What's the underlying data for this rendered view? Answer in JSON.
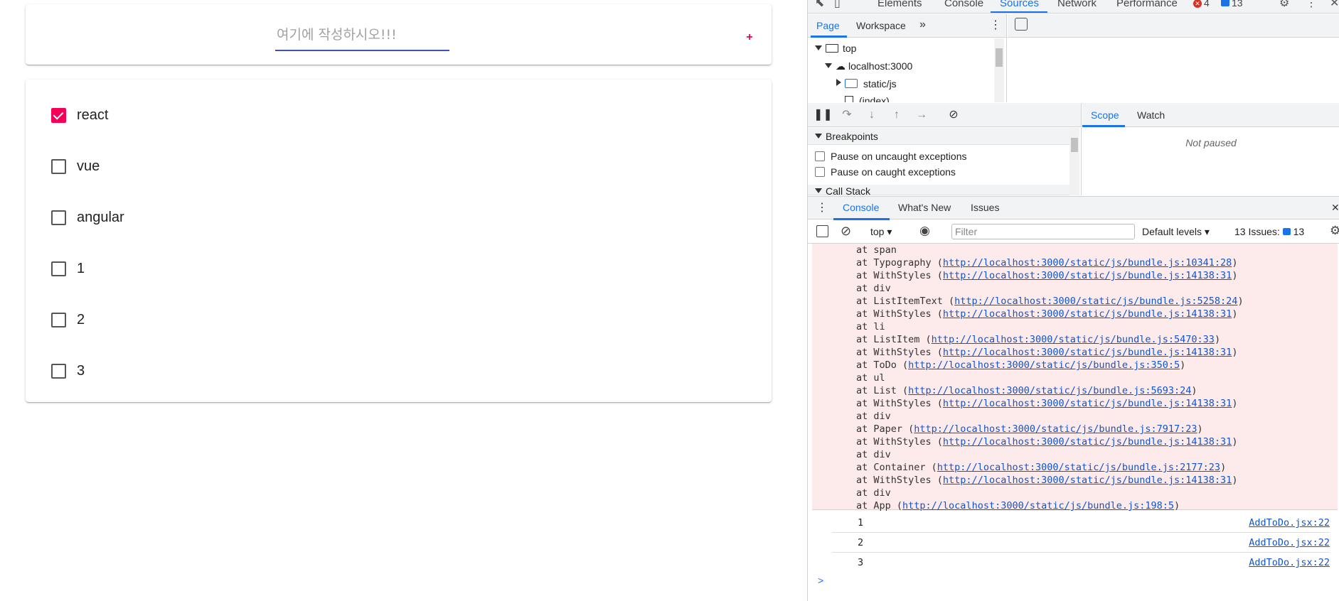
{
  "app": {
    "add_placeholder": "여기에 작성하시오!!!",
    "add_button": "+",
    "todos": [
      {
        "label": "react",
        "checked": true
      },
      {
        "label": "vue",
        "checked": false
      },
      {
        "label": "angular",
        "checked": false
      },
      {
        "label": "1",
        "checked": false
      },
      {
        "label": "2",
        "checked": false
      },
      {
        "label": "3",
        "checked": false
      }
    ]
  },
  "devtools": {
    "tabs": [
      "Elements",
      "Console",
      "Sources",
      "Network",
      "Performance"
    ],
    "active_tab": "Sources",
    "error_count": "4",
    "issue_count": "13",
    "navigator_tabs": [
      "Page",
      "Workspace"
    ],
    "tree": {
      "top": "top",
      "host": "localhost:3000",
      "folder": "static/js",
      "file": "(index)"
    },
    "breakpoints_title": "Breakpoints",
    "pause_uncaught": "Pause on uncaught exceptions",
    "pause_caught": "Pause on caught exceptions",
    "call_stack_title": "Call Stack",
    "scope_tabs": [
      "Scope",
      "Watch"
    ],
    "not_paused": "Not paused",
    "drawer_tabs": [
      "Console",
      "What's New",
      "Issues"
    ],
    "context": "top",
    "filter_placeholder": "Filter",
    "levels": "Default levels",
    "issues_label": "13 Issues:",
    "issues_count": "13",
    "stack": [
      {
        "text": "at span",
        "link": ""
      },
      {
        "text": "at Typography (",
        "link": "http://localhost:3000/static/js/bundle.js:10341:28"
      },
      {
        "text": "at WithStyles (",
        "link": "http://localhost:3000/static/js/bundle.js:14138:31"
      },
      {
        "text": "at div",
        "link": ""
      },
      {
        "text": "at ListItemText (",
        "link": "http://localhost:3000/static/js/bundle.js:5258:24"
      },
      {
        "text": "at WithStyles (",
        "link": "http://localhost:3000/static/js/bundle.js:14138:31"
      },
      {
        "text": "at li",
        "link": ""
      },
      {
        "text": "at ListItem (",
        "link": "http://localhost:3000/static/js/bundle.js:5470:33"
      },
      {
        "text": "at WithStyles (",
        "link": "http://localhost:3000/static/js/bundle.js:14138:31"
      },
      {
        "text": "at ToDo (",
        "link": "http://localhost:3000/static/js/bundle.js:350:5"
      },
      {
        "text": "at ul",
        "link": ""
      },
      {
        "text": "at List (",
        "link": "http://localhost:3000/static/js/bundle.js:5693:24"
      },
      {
        "text": "at WithStyles (",
        "link": "http://localhost:3000/static/js/bundle.js:14138:31"
      },
      {
        "text": "at div",
        "link": ""
      },
      {
        "text": "at Paper (",
        "link": "http://localhost:3000/static/js/bundle.js:7917:23"
      },
      {
        "text": "at WithStyles (",
        "link": "http://localhost:3000/static/js/bundle.js:14138:31"
      },
      {
        "text": "at div",
        "link": ""
      },
      {
        "text": "at Container (",
        "link": "http://localhost:3000/static/js/bundle.js:2177:23"
      },
      {
        "text": "at WithStyles (",
        "link": "http://localhost:3000/static/js/bundle.js:14138:31"
      },
      {
        "text": "at div",
        "link": ""
      },
      {
        "text": "at App (",
        "link": "http://localhost:3000/static/js/bundle.js:198:5"
      }
    ],
    "logs": [
      {
        "value": "1",
        "source": "AddToDo.jsx:22"
      },
      {
        "value": "2",
        "source": "AddToDo.jsx:22"
      },
      {
        "value": "3",
        "source": "AddToDo.jsx:22"
      }
    ],
    "prompt": ">"
  }
}
